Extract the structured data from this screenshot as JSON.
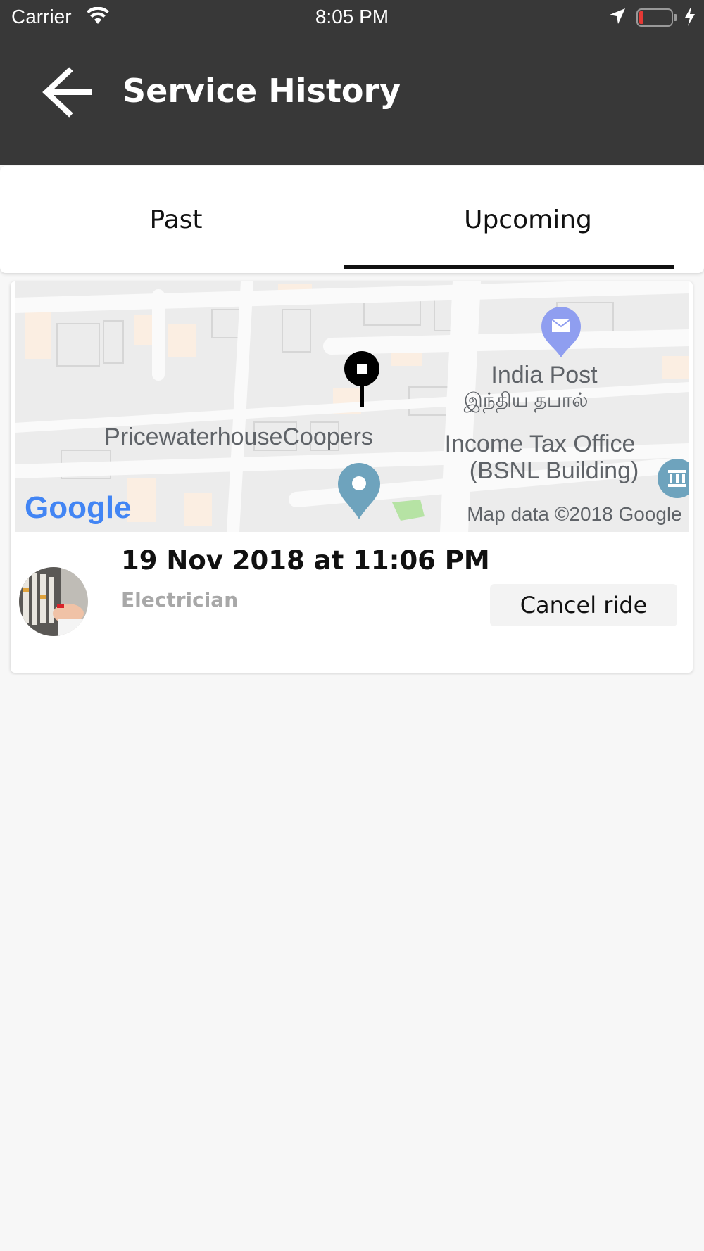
{
  "status_bar": {
    "carrier": "Carrier",
    "time": "8:05 PM",
    "icons": [
      "wifi-icon",
      "location-arrow-icon",
      "battery-icon",
      "charging-icon"
    ],
    "battery_level": 0.1,
    "battery_color": "#e53935"
  },
  "header": {
    "title": "Service History",
    "back_icon": "back-arrow-icon",
    "background": "#383838"
  },
  "tabs": {
    "items": [
      {
        "label": "Past",
        "selected": false
      },
      {
        "label": "Upcoming",
        "selected": true
      }
    ]
  },
  "ride": {
    "map": {
      "labels": {
        "india_post": "India Post",
        "india_post_tamil": "இந்திய தபால்",
        "pwc": "PricewaterhouseCoopers",
        "income_tax_1": "Income Tax Office",
        "income_tax_2": "(BSNL Building)",
        "google_logo": "Google",
        "attribution": "Map data ©2018 Google"
      },
      "icons": [
        "location-pin-icon",
        "mail-pin-icon",
        "place-pin-icon",
        "bank-pin-icon"
      ]
    },
    "date": "19 Nov 2018 at 11:06 PM",
    "service": "Electrician",
    "avatar_icon": "electrician-avatar",
    "cancel_label": "Cancel ride"
  }
}
